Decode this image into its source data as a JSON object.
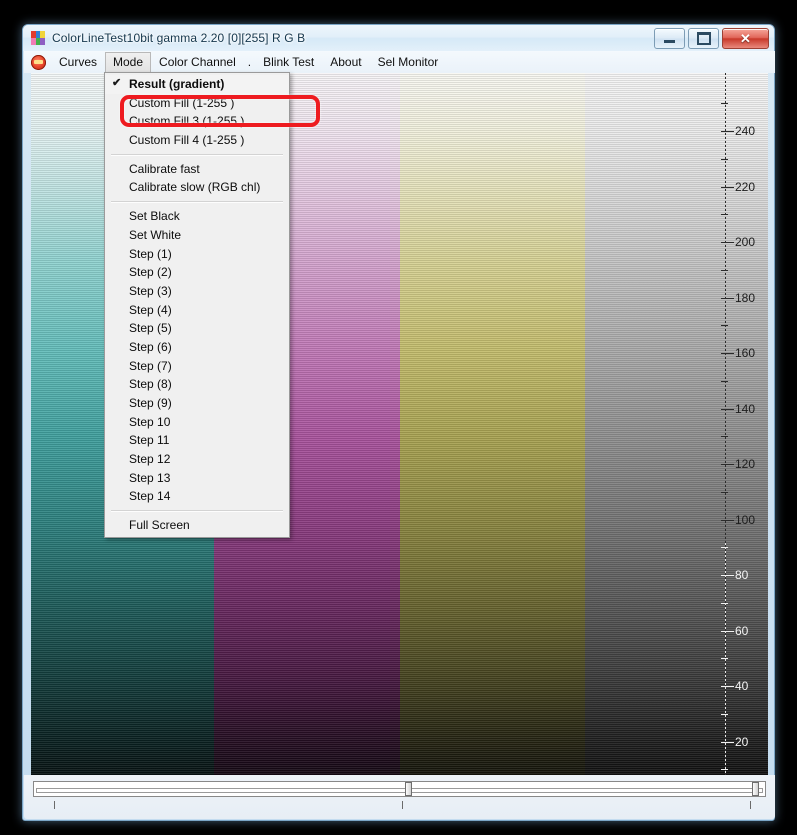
{
  "window": {
    "title": "ColorLineTest10bit gamma 2.20 [0][255]   R G B",
    "app_icon": "color-grid-icon",
    "caption_buttons": {
      "minimize": "minimize-icon",
      "maximize": "maximize-icon",
      "close": "✕"
    }
  },
  "menubar": {
    "icon": "curves-badge-icon",
    "items": [
      {
        "label": "Curves",
        "active": false
      },
      {
        "label": "Mode",
        "active": true
      },
      {
        "label": "Color Channel",
        "active": false
      },
      {
        "label": ".",
        "active": false
      },
      {
        "label": "Blink Test",
        "active": false
      },
      {
        "label": "About",
        "active": false
      },
      {
        "label": "Sel Monitor",
        "active": false
      }
    ]
  },
  "popup_menu": {
    "groups": [
      {
        "items": [
          {
            "label": "Result (gradient)",
            "checked": true
          },
          {
            "label": "Custom Fill  (1-255 )",
            "checked": false
          },
          {
            "label": "Custom Fill 3  (1-255 )",
            "checked": false
          },
          {
            "label": "Custom Fill 4  (1-255 )",
            "checked": false
          }
        ]
      },
      {
        "items": [
          {
            "label": "Calibrate fast",
            "checked": false
          },
          {
            "label": "Calibrate slow (RGB chl)",
            "checked": false
          }
        ]
      },
      {
        "items": [
          {
            "label": "Set Black",
            "checked": false
          },
          {
            "label": "Set White",
            "checked": false
          },
          {
            "label": "Step (1)",
            "checked": false
          },
          {
            "label": "Step (2)",
            "checked": false
          },
          {
            "label": "Step (3)",
            "checked": false
          },
          {
            "label": "Step (4)",
            "checked": false
          },
          {
            "label": "Step (5)",
            "checked": false
          },
          {
            "label": "Step (6)",
            "checked": false
          },
          {
            "label": "Step (7)",
            "checked": false
          },
          {
            "label": "Step (8)",
            "checked": false
          },
          {
            "label": "Step (9)",
            "checked": false
          },
          {
            "label": "Step 10",
            "checked": false
          },
          {
            "label": "Step 11",
            "checked": false
          },
          {
            "label": "Step 12",
            "checked": false
          },
          {
            "label": "Step 13",
            "checked": false
          },
          {
            "label": "Step 14",
            "checked": false
          }
        ]
      },
      {
        "items": [
          {
            "label": "Full Screen",
            "checked": false
          }
        ]
      }
    ],
    "check_glyph": "✔"
  },
  "annotation": {
    "shape": "rounded-rectangle",
    "color": "#ee1b20",
    "target": "Result (gradient)"
  },
  "gradient_canvas": {
    "bands": [
      {
        "name": "cyan-band",
        "top_color": "#f4f7f7",
        "bottom_color": "#050707"
      },
      {
        "name": "magenta-band",
        "top_color": "#f6f4f6",
        "bottom_color": "#070407"
      },
      {
        "name": "yellow-band",
        "top_color": "#f7f7f2",
        "bottom_color": "#070705"
      },
      {
        "name": "gray-band",
        "top_color": "#f5f5f5",
        "bottom_color": "#050505"
      }
    ]
  },
  "ruler": {
    "labels": [
      "240",
      "220",
      "200",
      "180",
      "160",
      "140",
      "120",
      "100",
      "80",
      "60",
      "40",
      "20"
    ],
    "unit_max": 255,
    "unit_min": 0
  },
  "bottom": {
    "slider_value": "",
    "thumb_positions": [
      "",
      ""
    ]
  }
}
